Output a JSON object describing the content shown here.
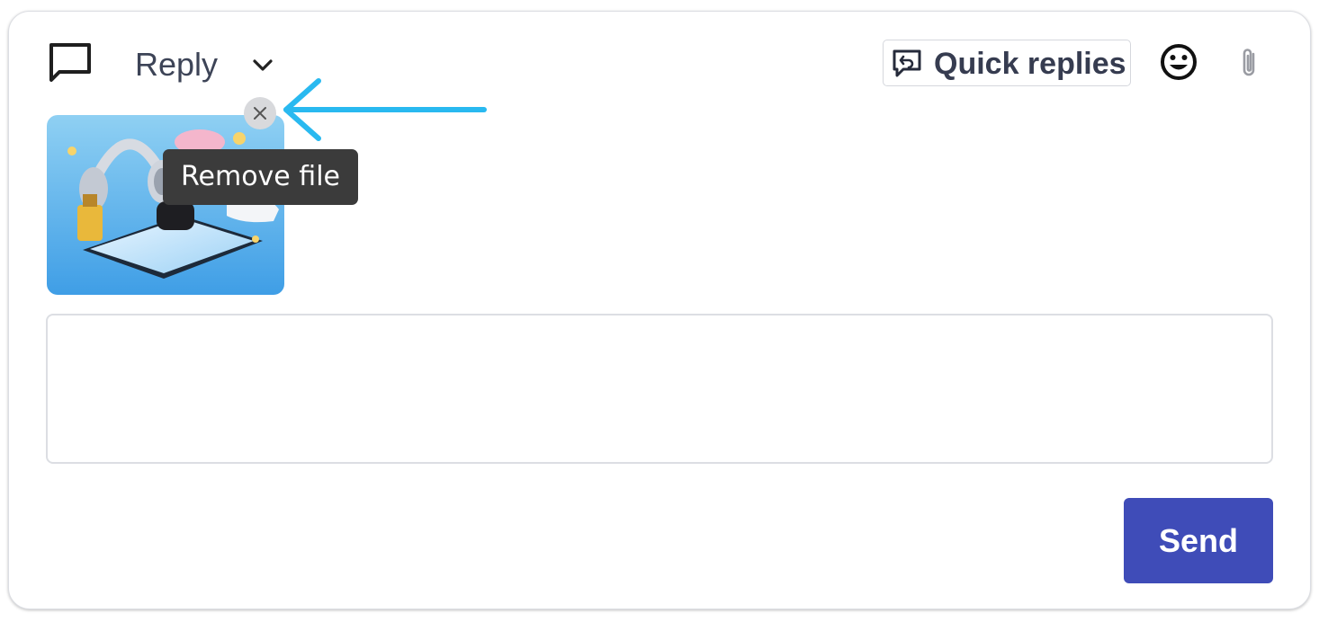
{
  "header": {
    "mode_label": "Reply",
    "quick_replies_label": "Quick replies",
    "icons": [
      "chat-bubble-icon",
      "chevron-down-icon",
      "quick-replies-icon",
      "emoji-icon",
      "paperclip-icon"
    ]
  },
  "attachment": {
    "thumbnail_icon": "image-thumbnail",
    "tooltip": "Remove file",
    "annotation_arrow_color": "#29b9f0"
  },
  "composer": {
    "message_value": "",
    "message_placeholder": ""
  },
  "actions": {
    "send_label": "Send"
  },
  "colors": {
    "send_button": "#3f4cb8",
    "tooltip_bg": "#3b3b3b",
    "text_primary": "#363c50"
  }
}
